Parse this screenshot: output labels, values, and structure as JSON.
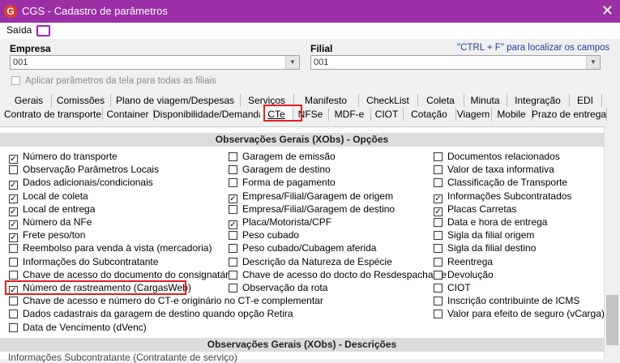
{
  "window": {
    "title": "CGS - Cadastro de parâmetros",
    "logo": "G",
    "close": "✕"
  },
  "menu": {
    "saida": "Saída"
  },
  "empresa": {
    "label": "Empresa",
    "value": "001"
  },
  "filial": {
    "label": "Filial",
    "value": "001"
  },
  "hint": "\"CTRL + F\" para localizar os campos",
  "apply_all": "Aplicar parâmetros da tela para todas as filiais",
  "tabs_row1": [
    "Gerais",
    "Comissões",
    "Plano de viagem/Despesas",
    "Serviços",
    "Manifesto",
    "CheckList",
    "Coleta",
    "Minuta",
    "Integração",
    "EDI"
  ],
  "tabs_row2": [
    "Contrato de transporte",
    "Container",
    "Disponibilidade/Demanda",
    "CTe",
    "NFSe",
    "MDF-e",
    "CIOT",
    "Cotação",
    "Viagem",
    "Mobile",
    "Prazo de entrega"
  ],
  "section1": "Observações Gerais (XObs) - Opções",
  "section2": "Observações Gerais (XObs) - Descrições",
  "cut_text": "Informações Subcontratante (Contratante de serviço)",
  "col1": [
    {
      "label": "Número do transporte",
      "checked": true
    },
    {
      "label": "Observação Parâmetros Locais",
      "checked": false
    },
    {
      "label": "Dados adicionais/condicionais",
      "checked": true
    },
    {
      "label": "Local de coleta",
      "checked": true
    },
    {
      "label": "Local de entrega",
      "checked": true
    },
    {
      "label": "Número da NFe",
      "checked": true
    },
    {
      "label": "Frete peso/ton",
      "checked": true
    },
    {
      "label": "Reembolso para venda à vista (mercadoria)",
      "checked": false
    },
    {
      "label": "Informações do Subcontratante",
      "checked": false
    },
    {
      "label": "Chave de acesso do documento do consignatário",
      "checked": false
    },
    {
      "label": "Número de rastreamento (CargasWeb)",
      "checked": true
    },
    {
      "label": "Chave de acesso e número do CT-e originário no CT-e complementar",
      "checked": false
    },
    {
      "label": "Dados cadastrais da garagem de destino quando opção Retira",
      "checked": false
    },
    {
      "label": "Data de Vencimento (dVenc)",
      "checked": false
    }
  ],
  "col2": [
    {
      "label": "Garagem de emissão",
      "checked": false
    },
    {
      "label": "Garagem de destino",
      "checked": false
    },
    {
      "label": "Forma de pagamento",
      "checked": false
    },
    {
      "label": "Empresa/Filial/Garagem de origem",
      "checked": true
    },
    {
      "label": "Empresa/Filial/Garagem de destino",
      "checked": false
    },
    {
      "label": "Placa/Motorista/CPF",
      "checked": true
    },
    {
      "label": "Peso cubado",
      "checked": false
    },
    {
      "label": "Peso cubado/Cubagem aferida",
      "checked": false
    },
    {
      "label": "Descrição da Natureza de Espécie",
      "checked": false
    },
    {
      "label": "Chave de acesso do docto do Resdespachante",
      "checked": false
    },
    {
      "label": "Observação da rota",
      "checked": false
    }
  ],
  "col3": [
    {
      "label": "Documentos relacionados",
      "checked": false
    },
    {
      "label": "Valor de taxa informativa",
      "checked": false
    },
    {
      "label": "Classificação de Transporte",
      "checked": false
    },
    {
      "label": "Informações Subcontratados",
      "checked": true
    },
    {
      "label": "Placas Carretas",
      "checked": true
    },
    {
      "label": "Data e hora de entrega",
      "checked": false
    },
    {
      "label": "Sigla da filial origem",
      "checked": false
    },
    {
      "label": "Sigla da filial destino",
      "checked": false
    },
    {
      "label": "Reentrega",
      "checked": false
    },
    {
      "label": "Devolução",
      "checked": false
    },
    {
      "label": "CIOT",
      "checked": false
    },
    {
      "label": "Inscrição contribuinte de ICMS",
      "checked": false
    },
    {
      "label": "Valor para efeito de seguro (vCarga)",
      "checked": false
    }
  ],
  "colors": {
    "titlebar": "#9b2fa6",
    "highlight": "#e02020",
    "hint": "#1a3fa0"
  }
}
